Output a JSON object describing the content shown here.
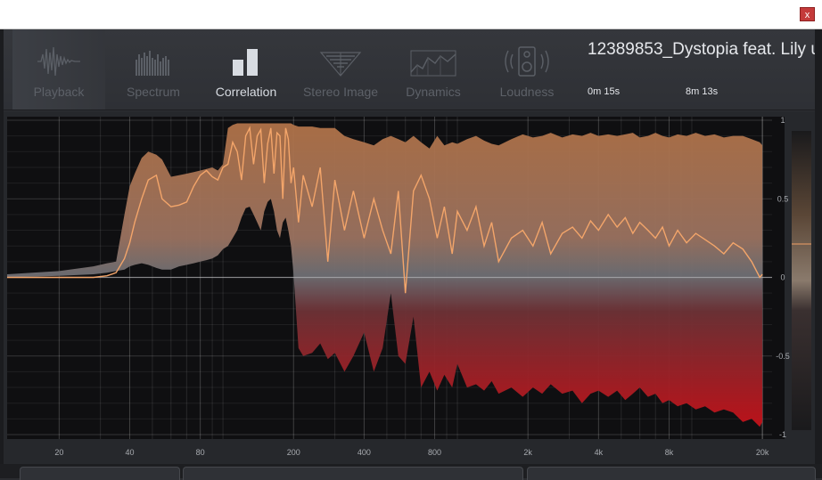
{
  "window": {
    "close_label": "x"
  },
  "tabs": [
    {
      "label": "Playback",
      "icon": "waveform-icon",
      "active": false
    },
    {
      "label": "Spectrum",
      "icon": "spectrum-bars-icon",
      "active": false
    },
    {
      "label": "Correlation",
      "icon": "correlation-bars-icon",
      "active": true
    },
    {
      "label": "Stereo Image",
      "icon": "stereo-image-icon",
      "active": false
    },
    {
      "label": "Dynamics",
      "icon": "dynamics-graph-icon",
      "active": false
    },
    {
      "label": "Loudness",
      "icon": "speaker-icon",
      "active": false
    }
  ],
  "track": {
    "title": "12389853_Dystopia feat. Lily u...",
    "elapsed": "0m 15s",
    "duration": "8m 13s"
  },
  "chart_data": {
    "type": "area",
    "x_scale": "log",
    "x_tick_labels": [
      "20",
      "40",
      "80",
      "200",
      "400",
      "800",
      "2k",
      "4k",
      "8k",
      "20k"
    ],
    "x_ticks": [
      20,
      40,
      80,
      200,
      400,
      800,
      2000,
      4000,
      8000,
      20000
    ],
    "y_tick_labels": [
      "1",
      "0.5",
      "0",
      "-0.5",
      "-1"
    ],
    "y_ticks": [
      1,
      0.5,
      0,
      -0.5,
      -1
    ],
    "ylim": [
      -1,
      1
    ],
    "xlim": [
      12,
      22000
    ],
    "grid": true,
    "colors": {
      "upper": "#b07248",
      "lower": "#b81418",
      "line": "#f3a56a",
      "background": "#0f0f11"
    },
    "series": [
      {
        "role": "range-max",
        "x": [
          12,
          20,
          28,
          32,
          35,
          38,
          40,
          42,
          45,
          48,
          52,
          55,
          60,
          65,
          70,
          75,
          80,
          85,
          90,
          95,
          100,
          105,
          110,
          115,
          120,
          125,
          130,
          135,
          140,
          145,
          150,
          155,
          160,
          165,
          170,
          175,
          180,
          185,
          190,
          195,
          200,
          210,
          220,
          240,
          260,
          280,
          300,
          330,
          360,
          400,
          440,
          480,
          520,
          560,
          600,
          650,
          700,
          760,
          820,
          880,
          950,
          1000,
          1100,
          1200,
          1300,
          1400,
          1500,
          1700,
          1900,
          2100,
          2300,
          2500,
          2800,
          3100,
          3400,
          3700,
          4000,
          4400,
          4800,
          5200,
          5600,
          6000,
          6500,
          7000,
          7500,
          8000,
          8700,
          9500,
          10400,
          11400,
          12500,
          13700,
          15000,
          16500,
          18000,
          19500,
          20000
        ],
        "y": [
          0.02,
          0.04,
          0.07,
          0.09,
          0.1,
          0.4,
          0.58,
          0.66,
          0.76,
          0.8,
          0.78,
          0.75,
          0.64,
          0.65,
          0.66,
          0.67,
          0.68,
          0.69,
          0.7,
          0.68,
          0.72,
          0.95,
          0.97,
          0.98,
          0.98,
          0.98,
          0.98,
          0.98,
          0.98,
          0.98,
          0.98,
          0.98,
          0.98,
          0.98,
          0.98,
          0.98,
          0.98,
          0.98,
          0.98,
          0.98,
          0.97,
          0.96,
          0.96,
          0.96,
          0.95,
          0.95,
          0.95,
          0.9,
          0.88,
          0.86,
          0.84,
          0.88,
          0.9,
          0.88,
          0.86,
          0.9,
          0.86,
          0.82,
          0.9,
          0.84,
          0.86,
          0.85,
          0.88,
          0.9,
          0.87,
          0.85,
          0.84,
          0.88,
          0.91,
          0.89,
          0.9,
          0.92,
          0.89,
          0.91,
          0.9,
          0.92,
          0.9,
          0.91,
          0.9,
          0.91,
          0.92,
          0.89,
          0.9,
          0.92,
          0.9,
          0.89,
          0.91,
          0.9,
          0.92,
          0.9,
          0.91,
          0.89,
          0.9,
          0.9,
          0.88,
          0.86,
          0.84
        ]
      },
      {
        "role": "range-min",
        "x": [
          12,
          20,
          28,
          32,
          35,
          38,
          40,
          42,
          45,
          48,
          52,
          55,
          60,
          65,
          70,
          75,
          80,
          85,
          90,
          95,
          100,
          105,
          110,
          115,
          120,
          125,
          130,
          135,
          140,
          145,
          150,
          155,
          160,
          165,
          170,
          175,
          180,
          185,
          190,
          195,
          200,
          210,
          220,
          240,
          260,
          280,
          300,
          330,
          360,
          400,
          440,
          480,
          520,
          560,
          600,
          650,
          700,
          760,
          820,
          880,
          950,
          1000,
          1100,
          1200,
          1300,
          1400,
          1500,
          1700,
          1900,
          2100,
          2300,
          2500,
          2800,
          3100,
          3400,
          3700,
          4000,
          4400,
          4800,
          5200,
          5600,
          6000,
          6500,
          7000,
          7500,
          8000,
          8700,
          9500,
          10400,
          11400,
          12500,
          13700,
          15000,
          16500,
          18000,
          19500,
          20000
        ],
        "y": [
          0.0,
          0.01,
          0.02,
          0.03,
          0.04,
          0.05,
          0.07,
          0.08,
          0.09,
          0.08,
          0.06,
          0.05,
          0.05,
          0.07,
          0.08,
          0.09,
          0.1,
          0.11,
          0.12,
          0.14,
          0.18,
          0.2,
          0.25,
          0.3,
          0.38,
          0.44,
          0.45,
          0.4,
          0.35,
          0.3,
          0.42,
          0.48,
          0.5,
          0.42,
          0.3,
          0.25,
          0.35,
          0.38,
          0.3,
          0.2,
          0.02,
          -0.45,
          -0.5,
          -0.48,
          -0.42,
          -0.52,
          -0.48,
          -0.6,
          -0.5,
          -0.35,
          -0.6,
          -0.45,
          -0.1,
          -0.5,
          -0.55,
          -0.25,
          -0.7,
          -0.6,
          -0.72,
          -0.62,
          -0.7,
          -0.55,
          -0.7,
          -0.68,
          -0.72,
          -0.66,
          -0.74,
          -0.7,
          -0.76,
          -0.7,
          -0.74,
          -0.68,
          -0.74,
          -0.72,
          -0.8,
          -0.74,
          -0.72,
          -0.76,
          -0.72,
          -0.78,
          -0.74,
          -0.7,
          -0.76,
          -0.74,
          -0.8,
          -0.78,
          -0.82,
          -0.8,
          -0.84,
          -0.82,
          -0.86,
          -0.84,
          -0.86,
          -0.92,
          -0.9,
          -0.95,
          -0.92
        ]
      },
      {
        "role": "average",
        "x": [
          12,
          20,
          28,
          32,
          35,
          38,
          40,
          42,
          45,
          48,
          52,
          55,
          60,
          65,
          70,
          75,
          80,
          85,
          90,
          95,
          100,
          105,
          110,
          115,
          120,
          125,
          130,
          135,
          140,
          145,
          150,
          155,
          160,
          165,
          170,
          175,
          180,
          185,
          190,
          195,
          200,
          210,
          220,
          240,
          260,
          280,
          300,
          330,
          360,
          400,
          440,
          480,
          520,
          560,
          600,
          650,
          700,
          760,
          820,
          880,
          950,
          1000,
          1100,
          1200,
          1300,
          1400,
          1500,
          1700,
          1900,
          2100,
          2300,
          2500,
          2800,
          3100,
          3400,
          3700,
          4000,
          4400,
          4800,
          5200,
          5600,
          6000,
          6500,
          7000,
          7500,
          8000,
          8700,
          9500,
          10400,
          11400,
          12500,
          13700,
          15000,
          16500,
          18000,
          19500,
          20000
        ],
        "y": [
          0.0,
          0.0,
          0.0,
          0.01,
          0.03,
          0.12,
          0.22,
          0.35,
          0.5,
          0.62,
          0.65,
          0.5,
          0.45,
          0.46,
          0.48,
          0.58,
          0.65,
          0.68,
          0.64,
          0.62,
          0.7,
          0.72,
          0.86,
          0.8,
          0.62,
          0.9,
          0.95,
          0.72,
          0.9,
          0.94,
          0.6,
          0.85,
          0.95,
          0.66,
          0.92,
          0.9,
          0.5,
          0.95,
          0.88,
          0.6,
          0.7,
          0.35,
          0.65,
          0.45,
          0.7,
          0.1,
          0.62,
          0.3,
          0.55,
          0.25,
          0.5,
          0.3,
          0.15,
          0.55,
          -0.1,
          0.55,
          0.65,
          0.5,
          0.25,
          0.45,
          0.15,
          0.42,
          0.3,
          0.45,
          0.2,
          0.35,
          0.1,
          0.25,
          0.3,
          0.2,
          0.35,
          0.15,
          0.28,
          0.32,
          0.25,
          0.36,
          0.3,
          0.4,
          0.32,
          0.38,
          0.28,
          0.35,
          0.3,
          0.25,
          0.32,
          0.2,
          0.3,
          0.22,
          0.28,
          0.24,
          0.2,
          0.15,
          0.22,
          0.18,
          0.1,
          0.0,
          0.02
        ]
      }
    ]
  }
}
